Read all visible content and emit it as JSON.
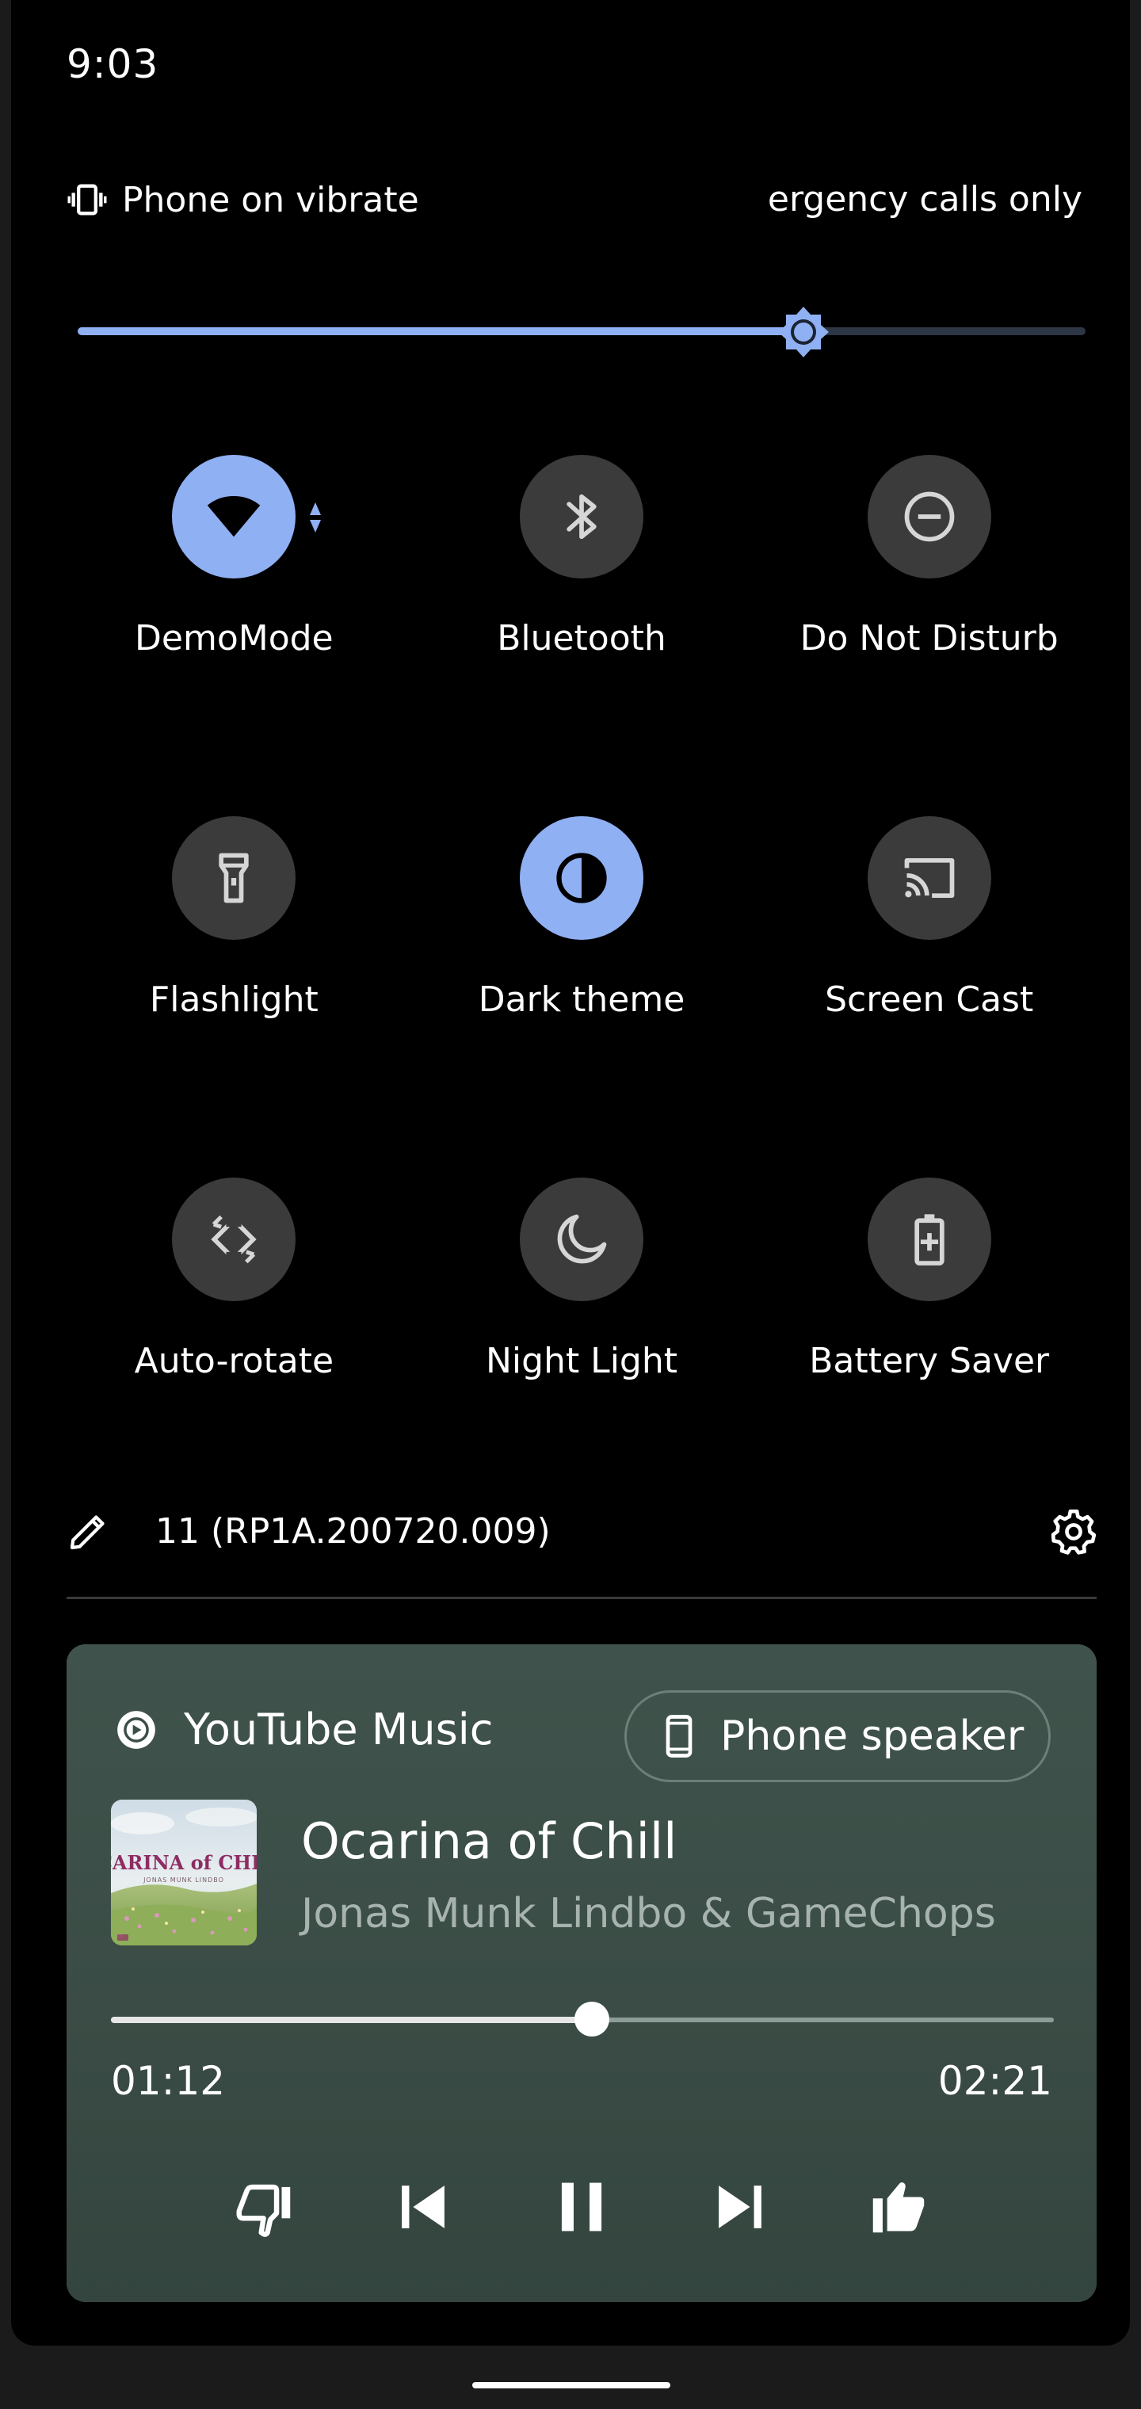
{
  "status_bar": {
    "time": "9:03"
  },
  "header": {
    "ringer_icon": "vibrate-icon",
    "ringer_label": "Phone on vibrate",
    "carrier_text": "Emergency calls only"
  },
  "brightness": {
    "icon": "brightness-icon",
    "level": 0.72,
    "accent": "#8fb0f2"
  },
  "tiles": [
    {
      "label": "DemoMode",
      "icon": "wifi-icon",
      "active": true
    },
    {
      "label": "Bluetooth",
      "icon": "bluetooth-icon",
      "active": false
    },
    {
      "label": "Do Not Disturb",
      "icon": "do-not-disturb-icon",
      "active": false
    },
    {
      "label": "Flashlight",
      "icon": "flashlight-icon",
      "active": false
    },
    {
      "label": "Dark theme",
      "icon": "dark-theme-icon",
      "active": true
    },
    {
      "label": "Screen Cast",
      "icon": "cast-icon",
      "active": false
    },
    {
      "label": "Auto-rotate",
      "icon": "auto-rotate-icon",
      "active": false
    },
    {
      "label": "Night Light",
      "icon": "night-light-icon",
      "active": false
    },
    {
      "label": "Battery Saver",
      "icon": "battery-saver-icon",
      "active": false
    }
  ],
  "footer": {
    "edit_icon": "edit-icon",
    "build_number": "11 (RP1A.200720.009)",
    "settings_icon": "settings-gear-icon"
  },
  "media": {
    "app_name": "YouTube Music",
    "output_label": "Phone speaker",
    "album_art": {
      "title_text": "OCARINA of CHILL",
      "artist_text": "JONAS MUNK LINDBO"
    },
    "title": "Ocarina of Chill",
    "artist": "Jonas Munk Lindbo & GameChops",
    "elapsed": "01:12",
    "duration": "02:21",
    "progress": 0.51,
    "card_color": "#3b4e47",
    "controls": [
      {
        "name": "thumbs-down-icon",
        "action": "dislike"
      },
      {
        "name": "skip-previous-icon",
        "action": "previous"
      },
      {
        "name": "pause-icon",
        "action": "pause"
      },
      {
        "name": "skip-next-icon",
        "action": "next"
      },
      {
        "name": "thumbs-up-icon",
        "action": "like"
      }
    ]
  }
}
